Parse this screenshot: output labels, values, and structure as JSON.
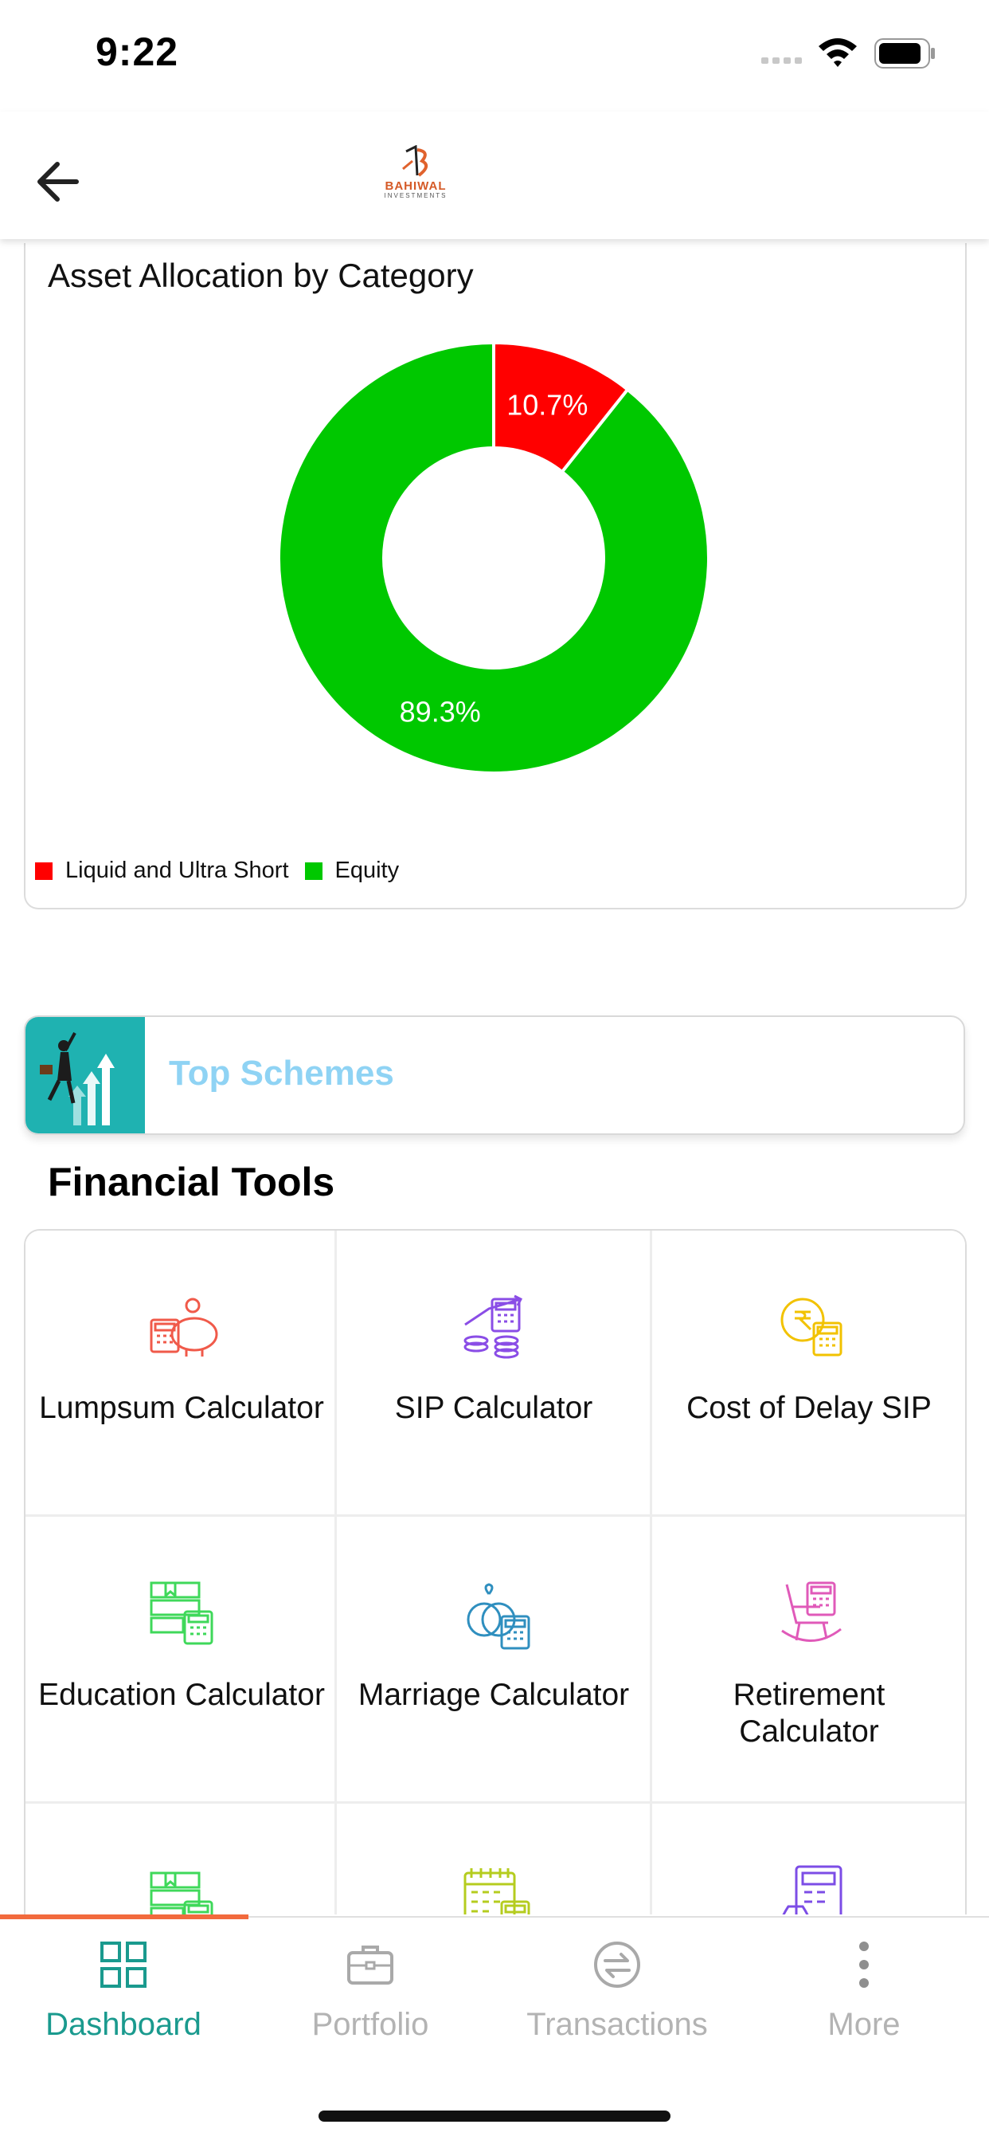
{
  "status_bar": {
    "time": "9:22"
  },
  "header": {
    "logo_text": "BAHIWAL",
    "logo_subtext": "INVESTMENTS"
  },
  "asset_card": {
    "title": "Asset Allocation by Category"
  },
  "chart_data": {
    "type": "pie",
    "title": "Asset Allocation by Category",
    "categories": [
      "Liquid and Ultra Short",
      "Equity"
    ],
    "values": [
      10.7,
      89.3
    ],
    "labels": [
      "10.7%",
      "89.3%"
    ],
    "colors": [
      "#ff0000",
      "#00c800"
    ],
    "legend": "bottom-left",
    "donut": true
  },
  "top_schemes": {
    "label": "Top Schemes"
  },
  "financial_tools": {
    "title": "Financial Tools",
    "items": [
      {
        "label": "Lumpsum Calculator",
        "icon": "piggy-bank-calculator-icon",
        "color": "#f05a4a"
      },
      {
        "label": "SIP Calculator",
        "icon": "coins-calculator-icon",
        "color": "#8a4de6"
      },
      {
        "label": "Cost of Delay SIP",
        "icon": "rupee-coin-calculator-icon",
        "color": "#f2c200"
      },
      {
        "label": "Education Calculator",
        "icon": "book-calculator-icon",
        "color": "#3fd85a"
      },
      {
        "label": "Marriage Calculator",
        "icon": "rings-calculator-icon",
        "color": "#2f8fbf"
      },
      {
        "label": "Retirement Calculator",
        "icon": "rocking-chair-calculator-icon",
        "color": "#e05ab9"
      },
      {
        "label": "",
        "icon": "books-calculator-icon",
        "color": "#3fd85a"
      },
      {
        "label": "",
        "icon": "calendar-calculator-icon",
        "color": "#b5cc1f"
      },
      {
        "label": "",
        "icon": "money-bag-calculator-icon",
        "color": "#7c4de6"
      }
    ]
  },
  "bottom_nav": {
    "tabs": [
      {
        "label": "Dashboard",
        "icon": "grid-icon",
        "active": true
      },
      {
        "label": "Portfolio",
        "icon": "briefcase-icon",
        "active": false
      },
      {
        "label": "Transactions",
        "icon": "exchange-icon",
        "active": false
      },
      {
        "label": "More",
        "icon": "more-vertical-icon",
        "active": false
      }
    ],
    "active_color": "#1a9a8e",
    "accent_color": "#f26a3d"
  }
}
